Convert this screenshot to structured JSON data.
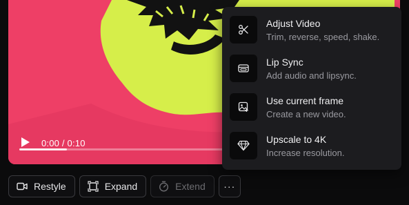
{
  "video": {
    "time_display": "0:00 / 0:10",
    "progress_fraction": 0.13,
    "colors": {
      "background": "#ee3f66",
      "blob": "#d6ee4a",
      "art": "#121212"
    }
  },
  "toolbar": {
    "restyle_label": "Restyle",
    "expand_label": "Expand",
    "extend_label": "Extend",
    "more_label": "···",
    "icons": [
      "video-camera-icon",
      "expand-frames-icon",
      "stopwatch-icon",
      "ellipsis-icon"
    ]
  },
  "menu": {
    "items": [
      {
        "icon": "scissors-icon",
        "title": "Adjust Video",
        "subtitle": "Trim, reverse, speed, shake."
      },
      {
        "icon": "lip-sync-icon",
        "title": "Lip Sync",
        "subtitle": "Add audio and lipsync."
      },
      {
        "icon": "image-frame-icon",
        "title": "Use current frame",
        "subtitle": "Create a new video."
      },
      {
        "icon": "diamond-icon",
        "title": "Upscale to 4K",
        "subtitle": "Increase resolution."
      }
    ]
  }
}
